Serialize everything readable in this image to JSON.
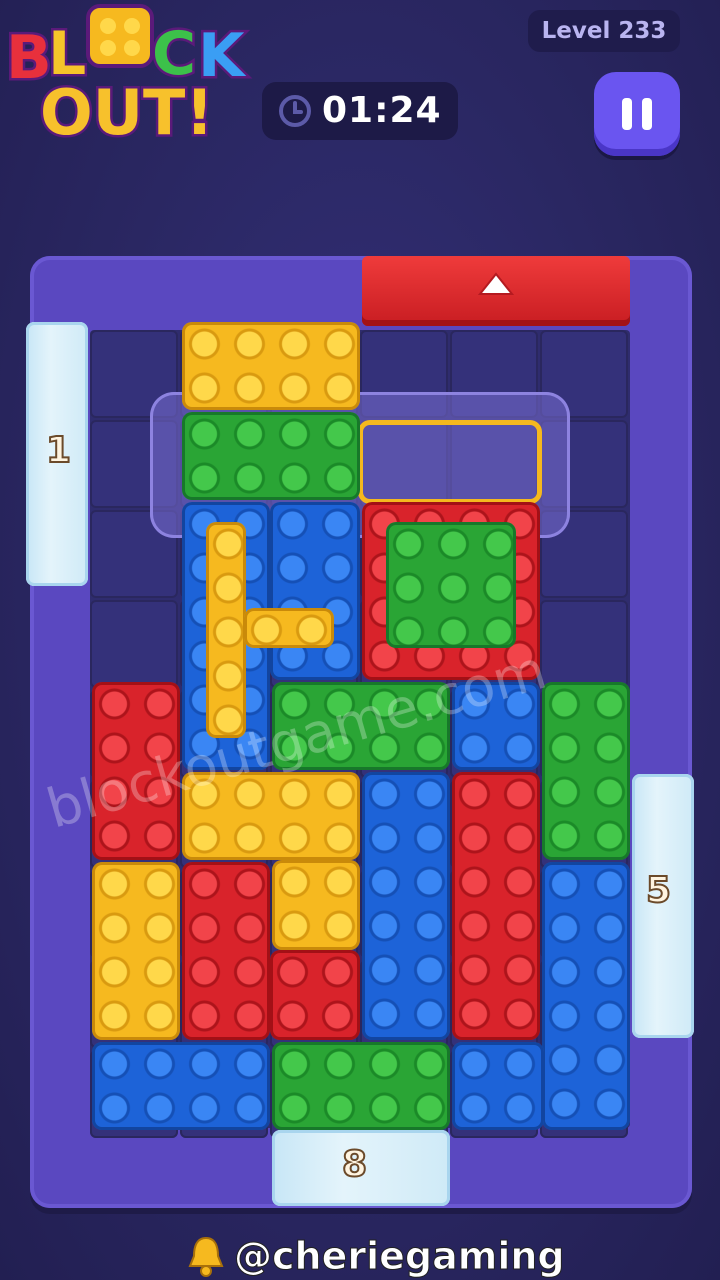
{
  "logo": {
    "line1": "BLOCK",
    "line2": "OUT!"
  },
  "header": {
    "level_label": "Level 233",
    "timer": "01:24"
  },
  "icons": {
    "clock": "clock-icon",
    "pause": "pause-icon",
    "bell": "bell-icon",
    "up_arrow": "up-arrow-icon"
  },
  "board": {
    "exits": [
      {
        "side": "left",
        "count": "1"
      },
      {
        "side": "right",
        "count": "5"
      },
      {
        "side": "bottom",
        "count": "8"
      }
    ],
    "exit_gate_color": "red"
  },
  "watermark": "blockoutgame.com",
  "credit": "@cheriegaming",
  "colors": {
    "yellow": "#f6b91f",
    "green": "#2aa535",
    "blue": "#1d63d8",
    "red": "#d9232b",
    "board": "#5a48c0",
    "accent_pause": "#6a55f0"
  }
}
